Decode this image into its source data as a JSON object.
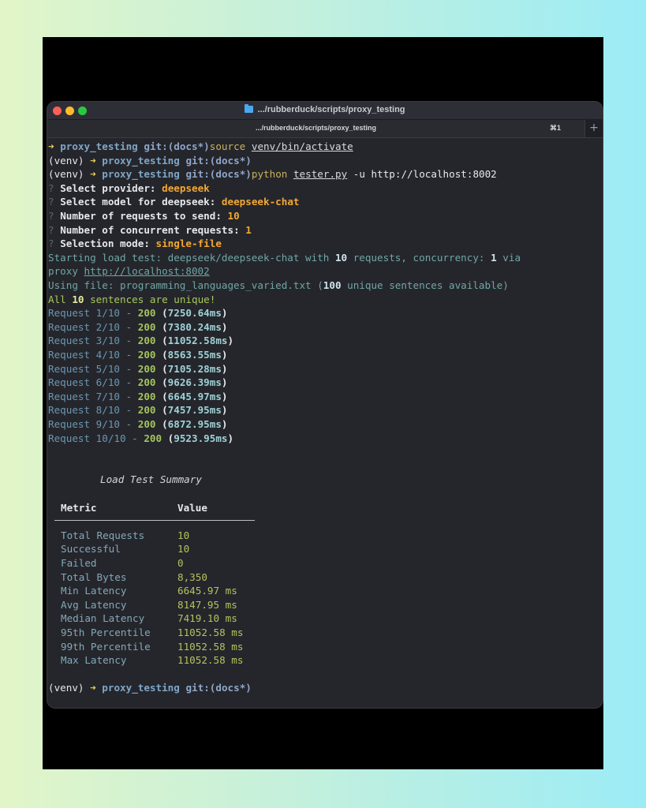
{
  "window": {
    "title": ".../rubberduck/scripts/proxy_testing",
    "tab_title": ".../rubberduck/scripts/proxy_testing",
    "tab_shortcut": "⌘1",
    "new_tab": "+"
  },
  "terminal": {
    "prompt1": {
      "arrow": "➜",
      "dir": "proxy_testing",
      "git": "git:(docs*)",
      "cmd": "source",
      "arg": "venv/bin/activate"
    },
    "prompt2": {
      "venv": "(venv)",
      "arrow": "➜",
      "dir": "proxy_testing",
      "git": "git:(docs*)"
    },
    "prompt3": {
      "venv": "(venv)",
      "arrow": "➜",
      "dir": "proxy_testing",
      "git": "git:(docs*)",
      "cmd": "python",
      "arg": "tester.py",
      "flags": "-u http://localhost:8002"
    },
    "prompts": [
      {
        "q": "?",
        "label": "Select provider:",
        "answer": "deepseek"
      },
      {
        "q": "?",
        "label": "Select model for deepseek:",
        "answer": "deepseek-chat"
      },
      {
        "q": "?",
        "label": "Number of requests to send:",
        "answer": "10"
      },
      {
        "q": "?",
        "label": "Number of concurrent requests:",
        "answer": "1"
      },
      {
        "q": "?",
        "label": "Selection mode:",
        "answer": "single-file"
      }
    ],
    "start_a": "Starting load test: deepseek/deepseek-chat with ",
    "start_count": "10",
    "start_b": " requests, concurrency: ",
    "start_conc": "1",
    "start_c": " via",
    "proxy_prefix": "proxy ",
    "proxy_url": "http://localhost:8002",
    "using_a": "Using file: programming_languages_varied.txt (",
    "using_count": "100",
    "using_b": " unique sentences available)",
    "unique_a": "All ",
    "unique_count": "10",
    "unique_b": " sentences are unique!",
    "requests": [
      {
        "label": "Request 1/10 - ",
        "code": "200",
        "ms": "7250.64ms"
      },
      {
        "label": "Request 2/10 - ",
        "code": "200",
        "ms": "7380.24ms"
      },
      {
        "label": "Request 3/10 - ",
        "code": "200",
        "ms": "11052.58ms"
      },
      {
        "label": "Request 4/10 - ",
        "code": "200",
        "ms": "8563.55ms"
      },
      {
        "label": "Request 5/10 - ",
        "code": "200",
        "ms": "7105.28ms"
      },
      {
        "label": "Request 6/10 - ",
        "code": "200",
        "ms": "9626.39ms"
      },
      {
        "label": "Request 7/10 - ",
        "code": "200",
        "ms": "6645.97ms"
      },
      {
        "label": "Request 8/10 - ",
        "code": "200",
        "ms": "7457.95ms"
      },
      {
        "label": "Request 9/10 - ",
        "code": "200",
        "ms": "6872.95ms"
      },
      {
        "label": "Request 10/10 - ",
        "code": "200",
        "ms": "9523.95ms"
      }
    ],
    "summary": {
      "title": "Load Test Summary",
      "col_metric": "Metric",
      "col_value": "Value",
      "rows": [
        {
          "metric": "Total Requests",
          "value": "10"
        },
        {
          "metric": "Successful",
          "value": "10"
        },
        {
          "metric": "Failed",
          "value": "0"
        },
        {
          "metric": "Total Bytes",
          "value": "8,350"
        },
        {
          "metric": "Min Latency",
          "value": "6645.97 ms"
        },
        {
          "metric": "Avg Latency",
          "value": "8147.95 ms"
        },
        {
          "metric": "Median Latency",
          "value": "7419.10 ms"
        },
        {
          "metric": "95th Percentile",
          "value": "11052.58 ms"
        },
        {
          "metric": "99th Percentile",
          "value": "11052.58 ms"
        },
        {
          "metric": "Max Latency",
          "value": "11052.58 ms"
        }
      ]
    },
    "prompt4": {
      "venv": "(venv)",
      "arrow": "➜",
      "dir": "proxy_testing",
      "git": "git:(docs*)"
    }
  }
}
